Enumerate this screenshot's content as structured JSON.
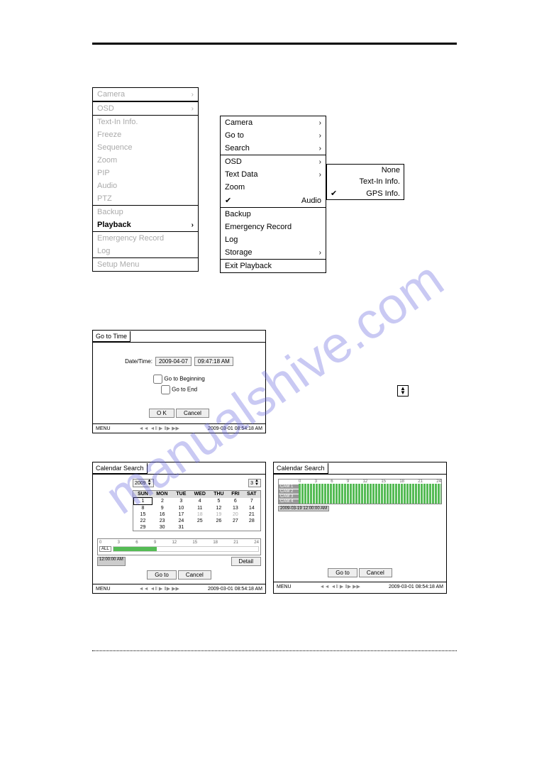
{
  "menu1": {
    "items": [
      {
        "label": "Camera",
        "arrow": true,
        "cls": "disabled",
        "sep": false
      },
      {
        "label": "OSD",
        "arrow": true,
        "cls": "disabled",
        "sep": true
      },
      {
        "label": "Text-In Info.",
        "arrow": false,
        "cls": "disabled",
        "sep": false
      },
      {
        "label": "Freeze",
        "arrow": false,
        "cls": "disabled",
        "sep": false
      },
      {
        "label": "Sequence",
        "arrow": false,
        "cls": "disabled",
        "sep": false
      },
      {
        "label": "Zoom",
        "arrow": false,
        "cls": "disabled",
        "sep": false
      },
      {
        "label": "PIP",
        "arrow": false,
        "cls": "disabled",
        "sep": false
      },
      {
        "label": "Audio",
        "arrow": false,
        "cls": "disabled",
        "sep": false
      },
      {
        "label": "PTZ",
        "arrow": false,
        "cls": "disabled",
        "sep": false
      },
      {
        "label": "Backup",
        "arrow": false,
        "cls": "disabled",
        "sep": true
      },
      {
        "label": "Playback",
        "arrow": true,
        "cls": "active",
        "sep": false
      },
      {
        "label": "Emergency Record",
        "arrow": false,
        "cls": "disabled",
        "sep": true
      },
      {
        "label": "Log",
        "arrow": false,
        "cls": "disabled",
        "sep": false
      },
      {
        "label": "Setup Menu",
        "arrow": false,
        "cls": "disabled",
        "sep": true
      }
    ]
  },
  "menu2": {
    "items": [
      {
        "label": "Camera",
        "arrow": true,
        "cls": "normal",
        "sep": false,
        "check": false
      },
      {
        "label": "Go to",
        "arrow": true,
        "cls": "normal",
        "sep": false,
        "check": false
      },
      {
        "label": "Search",
        "arrow": true,
        "cls": "normal",
        "sep": false,
        "check": false
      },
      {
        "label": "OSD",
        "arrow": true,
        "cls": "normal",
        "sep": true,
        "check": false
      },
      {
        "label": "Text Data",
        "arrow": true,
        "cls": "normal",
        "sep": false,
        "check": false
      },
      {
        "label": "Zoom",
        "arrow": false,
        "cls": "normal",
        "sep": false,
        "check": false
      },
      {
        "label": "Audio",
        "arrow": false,
        "cls": "normal",
        "sep": false,
        "check": true
      },
      {
        "label": "Backup",
        "arrow": false,
        "cls": "normal",
        "sep": true,
        "check": false
      },
      {
        "label": "Emergency Record",
        "arrow": false,
        "cls": "normal",
        "sep": false,
        "check": false
      },
      {
        "label": "Log",
        "arrow": false,
        "cls": "normal",
        "sep": false,
        "check": false
      },
      {
        "label": "Storage",
        "arrow": true,
        "cls": "normal",
        "sep": false,
        "check": false
      },
      {
        "label": "Exit Playback",
        "arrow": false,
        "cls": "normal",
        "sep": true,
        "check": false
      }
    ]
  },
  "submenu": {
    "items": [
      {
        "label": "None",
        "check": false
      },
      {
        "label": "Text-In Info.",
        "check": false
      },
      {
        "label": "GPS Info.",
        "check": true
      }
    ]
  },
  "gototime": {
    "title": "Go to Time",
    "dt_label": "Date/Time:",
    "date": "2009-04-07",
    "time": "09:47:18 AM",
    "cb1": "Go to Beginning",
    "cb2": "Go to End",
    "ok": "O K",
    "cancel": "Cancel",
    "menu": "MENU",
    "status_time": "2009-03-01 08:54:18 AM"
  },
  "calsearch1": {
    "title": "Calendar Search",
    "year": "2009",
    "month": "3",
    "days": [
      "SUN",
      "MON",
      "TUE",
      "WED",
      "THU",
      "FRI",
      "SAT"
    ],
    "weeks": [
      [
        "1",
        "2",
        "3",
        "4",
        "5",
        "6",
        "7"
      ],
      [
        "8",
        "9",
        "10",
        "11",
        "12",
        "13",
        "14"
      ],
      [
        "15",
        "16",
        "17",
        "18",
        "19",
        "20",
        "21"
      ],
      [
        "22",
        "23",
        "24",
        "25",
        "26",
        "27",
        "28"
      ],
      [
        "29",
        "30",
        "31",
        "",
        "",
        "",
        ""
      ]
    ],
    "all_label": "ALL",
    "scale": [
      "0",
      "3",
      "6",
      "9",
      "12",
      "15",
      "18",
      "21",
      "24"
    ],
    "time": "12:00:00 AM",
    "detail": "Detail",
    "goto": "Go to",
    "cancel": "Cancel",
    "menu": "MENU",
    "status_time": "2009-03-01 08:54:18 AM"
  },
  "calsearch2": {
    "title": "Calendar Search",
    "cams": [
      "CAM 1",
      "CAM 2",
      "CAM 3",
      "CAM 4"
    ],
    "scale": [
      "0",
      "3",
      "6",
      "9",
      "12",
      "15",
      "18",
      "21",
      "24"
    ],
    "datetime": "2009-03-19 12:00:00 AM",
    "goto": "Go to",
    "cancel": "Cancel",
    "menu": "MENU",
    "status_time": "2009-03-01 08:54:18 AM"
  },
  "watermark": "manualshive.com"
}
